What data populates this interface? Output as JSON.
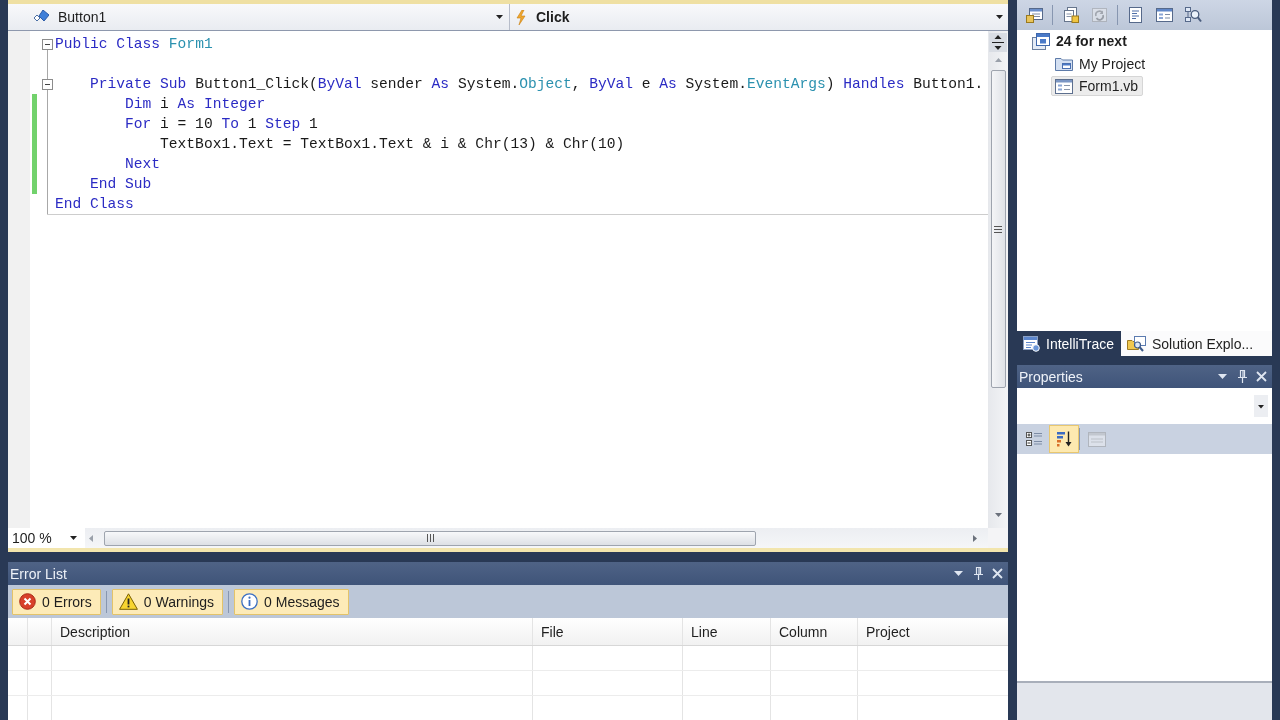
{
  "editor": {
    "type_dropdown": {
      "value": "Button1"
    },
    "member_dropdown": {
      "value": "Click"
    },
    "lines": [
      {
        "tokens": [
          {
            "kind": "keyword",
            "text": "Public Class "
          },
          {
            "kind": "type",
            "text": "Form1"
          }
        ],
        "changed": false,
        "foldable": true
      },
      {
        "changed": false,
        "foldable": false
      },
      {
        "tokens": [
          {
            "kind": "keyword",
            "text": "    Private Sub "
          },
          {
            "kind": "plain",
            "text": "Button1_Click("
          },
          {
            "kind": "keyword",
            "text": "ByVal "
          },
          {
            "kind": "plain",
            "text": "sender "
          },
          {
            "kind": "keyword",
            "text": "As "
          },
          {
            "kind": "plain",
            "text": "System."
          },
          {
            "kind": "type",
            "text": "Object"
          },
          {
            "kind": "plain",
            "text": ", "
          },
          {
            "kind": "keyword",
            "text": "ByVal "
          },
          {
            "kind": "plain",
            "text": "e "
          },
          {
            "kind": "keyword",
            "text": "As "
          },
          {
            "kind": "plain",
            "text": "System."
          },
          {
            "kind": "type",
            "text": "EventArgs"
          },
          {
            "kind": "plain",
            "text": ") "
          },
          {
            "kind": "keyword",
            "text": "Handles "
          },
          {
            "kind": "plain",
            "text": "Button1."
          }
        ],
        "changed": false,
        "foldable": true
      },
      {
        "tokens": [
          {
            "kind": "keyword",
            "text": "        Dim "
          },
          {
            "kind": "plain",
            "text": "i "
          },
          {
            "kind": "keyword",
            "text": "As Integer"
          }
        ],
        "changed": true,
        "foldable": false
      },
      {
        "tokens": [
          {
            "kind": "keyword",
            "text": "        For "
          },
          {
            "kind": "plain",
            "text": "i = 10 "
          },
          {
            "kind": "keyword",
            "text": "To "
          },
          {
            "kind": "plain",
            "text": "1 "
          },
          {
            "kind": "keyword",
            "text": "Step "
          },
          {
            "kind": "plain",
            "text": "1"
          }
        ],
        "changed": true,
        "foldable": false
      },
      {
        "tokens": [
          {
            "kind": "plain",
            "text": "            TextBox1.Text = TextBox1.Text & i & Chr(13) & Chr(10)"
          }
        ],
        "changed": true,
        "foldable": false
      },
      {
        "tokens": [
          {
            "kind": "keyword",
            "text": "        Next"
          }
        ],
        "changed": true,
        "foldable": false
      },
      {
        "tokens": [
          {
            "kind": "keyword",
            "text": "    End Sub"
          }
        ],
        "changed": true,
        "foldable": false
      },
      {
        "tokens": [
          {
            "kind": "keyword",
            "text": "End Class"
          }
        ],
        "changed": false,
        "foldable": false
      }
    ],
    "zoom": {
      "value": "100 %"
    }
  },
  "error_list": {
    "title": "Error List",
    "filters": [
      {
        "kind": "error",
        "label": "0 Errors",
        "selected": true
      },
      {
        "kind": "warning",
        "label": "0 Warnings",
        "selected": true
      },
      {
        "kind": "info",
        "label": "0 Messages",
        "selected": true
      }
    ],
    "columns": [
      "Description",
      "File",
      "Line",
      "Column",
      "Project"
    ]
  },
  "solution_explorer": {
    "toolbar_groups": [
      [
        {
          "kind": "properties",
          "disabled": false
        }
      ],
      [
        {
          "kind": "show_all_files",
          "disabled": false
        },
        {
          "kind": "refresh",
          "disabled": true
        }
      ],
      [
        {
          "kind": "view_code",
          "disabled": false
        },
        {
          "kind": "view_designer",
          "disabled": false
        },
        {
          "kind": "class_diagram",
          "disabled": false
        }
      ]
    ],
    "tree": [
      {
        "label": "24 for next",
        "kind": "project",
        "selected": false,
        "children": [
          {
            "label": "My Project",
            "kind": "my_project",
            "selected": false
          },
          {
            "label": "Form1.vb",
            "kind": "form",
            "selected": true
          }
        ]
      }
    ]
  },
  "panel_tabs": [
    {
      "label": "IntelliTrace",
      "kind": "intellitrace",
      "selected": false
    },
    {
      "label": "Solution Explo...",
      "kind": "solution_explorer",
      "selected": true
    }
  ],
  "properties": {
    "title": "Properties",
    "toolbar_groups": [
      [
        {
          "kind": "categorized",
          "selected": false,
          "disabled": false
        },
        {
          "kind": "alphabetical",
          "selected": true,
          "disabled": false
        }
      ],
      [
        {
          "kind": "property_pages",
          "selected": false,
          "disabled": true
        }
      ]
    ]
  }
}
